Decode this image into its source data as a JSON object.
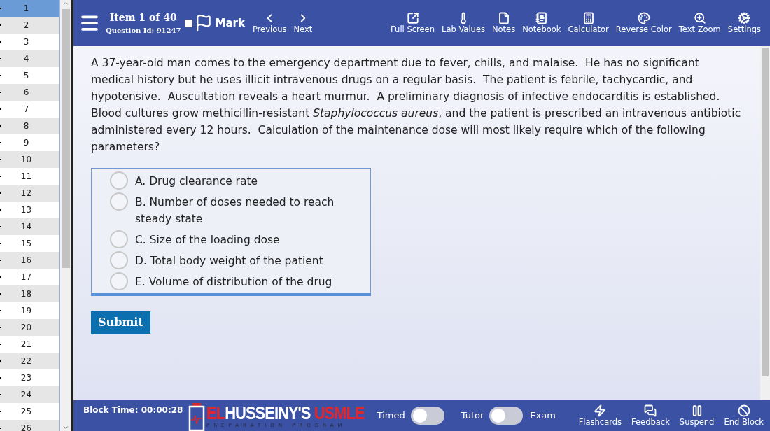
{
  "sidebar": {
    "items": [
      {
        "label": "1",
        "selected": true
      },
      {
        "label": "2",
        "selected": false
      },
      {
        "label": "3",
        "selected": false
      },
      {
        "label": "4",
        "selected": false
      },
      {
        "label": "5",
        "selected": false
      },
      {
        "label": "6",
        "selected": false
      },
      {
        "label": "7",
        "selected": false
      },
      {
        "label": "8",
        "selected": false
      },
      {
        "label": "9",
        "selected": false
      },
      {
        "label": "10",
        "selected": false
      },
      {
        "label": "11",
        "selected": false
      },
      {
        "label": "12",
        "selected": false
      },
      {
        "label": "13",
        "selected": false
      },
      {
        "label": "14",
        "selected": false
      },
      {
        "label": "15",
        "selected": false
      },
      {
        "label": "16",
        "selected": false
      },
      {
        "label": "17",
        "selected": false
      },
      {
        "label": "18",
        "selected": false
      },
      {
        "label": "19",
        "selected": false
      },
      {
        "label": "20",
        "selected": false
      },
      {
        "label": "21",
        "selected": false
      },
      {
        "label": "22",
        "selected": false
      },
      {
        "label": "23",
        "selected": false
      },
      {
        "label": "24",
        "selected": false
      },
      {
        "label": "25",
        "selected": false
      },
      {
        "label": "26",
        "selected": false
      }
    ]
  },
  "toolbar": {
    "item_counter": "Item 1 of 40",
    "question_id": "Question Id: 91247",
    "mark": {
      "label": "Mark",
      "checked": false
    },
    "buttons": [
      {
        "kind": "previous",
        "label": "Previous"
      },
      {
        "kind": "next",
        "label": "Next"
      },
      {
        "kind": "fullscreen",
        "label": "Full Screen"
      },
      {
        "kind": "lab",
        "label": "Lab Values"
      },
      {
        "kind": "notes",
        "label": "Notes"
      },
      {
        "kind": "notebook",
        "label": "Notebook"
      },
      {
        "kind": "calculator",
        "label": "Calculator"
      },
      {
        "kind": "palette",
        "label": "Reverse Color"
      },
      {
        "kind": "zoom",
        "label": "Text Zoom"
      },
      {
        "kind": "settings",
        "label": "Settings"
      }
    ]
  },
  "question": {
    "stem": "A 37-year-old man comes to the emergency department due to fever, chills, and malaise.  He has no significant medical history but he uses illicit intravenous drugs on a regular basis.  The patient is febrile, tachycardic, and hypotensive.  Auscultation reveals a heart murmur.  A preliminary diagnosis of infective endocarditis is established.  Blood cultures grow methicillin-resistant *Staphylococcus aureus*, and the patient is prescribed an intravenous antibiotic administered every 12 hours.  Calculation of the maintenance dose will most likely require which of the following parameters?",
    "options": [
      {
        "label": "A. Drug clearance rate",
        "selected": false
      },
      {
        "label": "B. Number of doses needed to reach steady state",
        "selected": false
      },
      {
        "label": "C. Size of the loading dose",
        "selected": false
      },
      {
        "label": "D. Total body weight of the patient",
        "selected": false
      },
      {
        "label": "E. Volume of distribution of the drug",
        "selected": false
      }
    ],
    "submit": "Submit"
  },
  "status_bar": {
    "block_time": "Block Time: 00:00:28",
    "logo": {
      "parts": [
        {
          "text": "EL",
          "accent": true
        },
        {
          "text": "HUSSEINY'S ",
          "accent": false
        },
        {
          "text": "USMLE",
          "accent": true
        }
      ],
      "tagline": "PREPARATION PROGRAM"
    },
    "timed": {
      "label": "Timed",
      "on": false
    },
    "mode": {
      "left": "Tutor",
      "right": "Exam",
      "on": false
    },
    "buttons": [
      {
        "kind": "flashcards",
        "label": "Flashcards"
      },
      {
        "kind": "feedback",
        "label": "Feedback"
      },
      {
        "kind": "suspend",
        "label": "Suspend"
      },
      {
        "kind": "end",
        "label": "End Block"
      }
    ]
  }
}
